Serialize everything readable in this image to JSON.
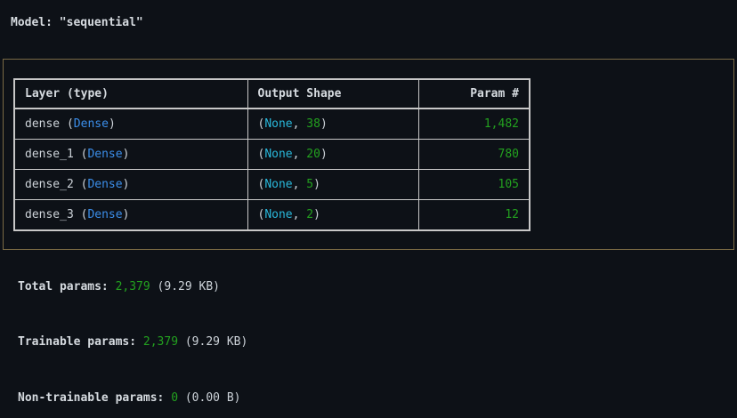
{
  "model": {
    "title_prefix": "Model: ",
    "name_quoted": "\"sequential\""
  },
  "table": {
    "headers": {
      "layer": "Layer (type)",
      "output_shape": "Output Shape",
      "params": "Param #"
    },
    "rows": [
      {
        "name": "dense",
        "type": "Dense",
        "shape_none": "None",
        "shape_dim": "38",
        "params": "1,482"
      },
      {
        "name": "dense_1",
        "type": "Dense",
        "shape_none": "None",
        "shape_dim": "20",
        "params": "780"
      },
      {
        "name": "dense_2",
        "type": "Dense",
        "shape_none": "None",
        "shape_dim": "5",
        "params": "105"
      },
      {
        "name": "dense_3",
        "type": "Dense",
        "shape_none": "None",
        "shape_dim": "2",
        "params": "12"
      }
    ]
  },
  "totals": {
    "total": {
      "label": "Total params:",
      "value": "2,379",
      "size": "(9.29 KB)"
    },
    "trainable": {
      "label": "Trainable params:",
      "value": "2,379",
      "size": "(9.29 KB)"
    },
    "non_trainable": {
      "label": "Non-trainable params:",
      "value": "0",
      "size": "(0.00 B)"
    }
  },
  "colors": {
    "background": "#0d1117",
    "text": "#cdd3d9",
    "layer_type": "#3b8eea",
    "none_keyword": "#29b8db",
    "numbers": "#23a11f",
    "panel_border": "#7a6a45",
    "table_border": "#c8c8c8"
  }
}
